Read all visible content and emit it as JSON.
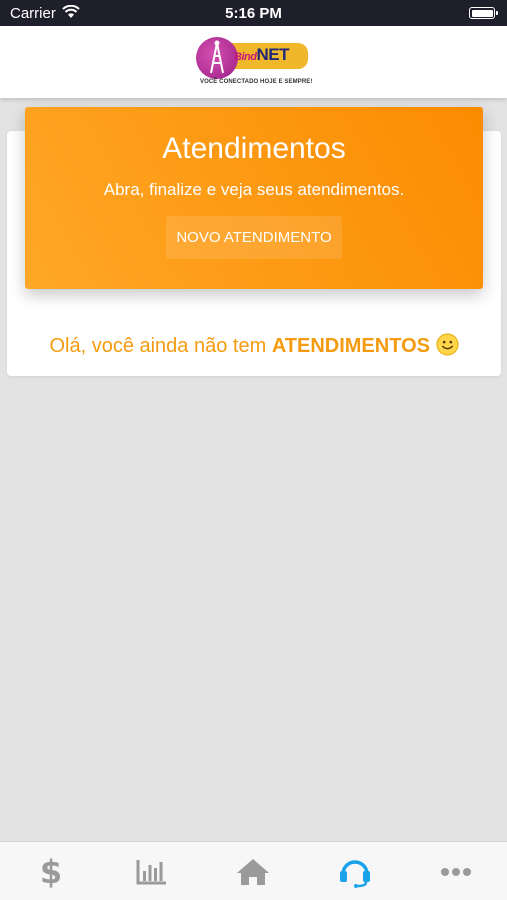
{
  "status_bar": {
    "carrier": "Carrier",
    "time": "5:16 PM"
  },
  "header": {
    "logo_brand_prefix": "Bind",
    "logo_brand_main": "NET",
    "logo_tagline": "VOCÊ CONECTADO HOJE E SEMPRE!"
  },
  "banner": {
    "title": "Atendimentos",
    "subtitle": "Abra, finalize e veja seus atendimentos.",
    "button_label": "NOVO ATENDIMENTO"
  },
  "empty_state": {
    "text": "Olá, você ainda não tem ",
    "highlight": "ATENDIMENTOS"
  },
  "tab_bar": {
    "tabs": [
      {
        "icon": "dollar-icon",
        "active": false
      },
      {
        "icon": "bar-chart-icon",
        "active": false
      },
      {
        "icon": "home-icon",
        "active": false
      },
      {
        "icon": "headset-icon",
        "active": true
      },
      {
        "icon": "more-icon",
        "active": false
      }
    ]
  },
  "colors": {
    "accent_orange": "#fb8c00",
    "text_orange": "#f59b10",
    "tab_inactive": "#9a9a9a",
    "tab_active": "#1aa3e8"
  }
}
